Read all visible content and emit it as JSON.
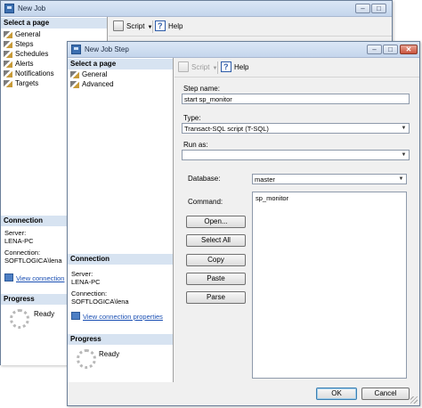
{
  "back_window": {
    "title": "New Job",
    "select_page_header": "Select a page",
    "pages": [
      {
        "label": "General"
      },
      {
        "label": "Steps"
      },
      {
        "label": "Schedules"
      },
      {
        "label": "Alerts"
      },
      {
        "label": "Notifications"
      },
      {
        "label": "Targets"
      }
    ],
    "toolbar": {
      "script_label": "Script",
      "help_label": "Help"
    },
    "connection": {
      "header": "Connection",
      "server_label": "Server:",
      "server_value": "LENA-PC",
      "connection_label": "Connection:",
      "connection_value": "SOFTLOGICA\\lena",
      "link_text": "View connection"
    },
    "progress": {
      "header": "Progress",
      "status": "Ready"
    }
  },
  "front_window": {
    "title": "New Job Step",
    "select_page_header": "Select a page",
    "pages": [
      {
        "label": "General"
      },
      {
        "label": "Advanced"
      }
    ],
    "toolbar": {
      "script_label": "Script",
      "help_label": "Help"
    },
    "form": {
      "step_name_label": "Step name:",
      "step_name_value": "start sp_monitor",
      "type_label": "Type:",
      "type_value": "Transact-SQL script (T-SQL)",
      "run_as_label": "Run as:",
      "run_as_value": "",
      "database_label": "Database:",
      "database_value": "master",
      "command_label": "Command:",
      "command_value": "sp_monitor"
    },
    "buttons": {
      "open": "Open...",
      "select_all": "Select All",
      "copy": "Copy",
      "paste": "Paste",
      "parse": "Parse"
    },
    "connection": {
      "header": "Connection",
      "server_label": "Server:",
      "server_value": "LENA-PC",
      "connection_label": "Connection:",
      "connection_value": "SOFTLOGICA\\lena",
      "link_text": "View connection properties"
    },
    "progress": {
      "header": "Progress",
      "status": "Ready"
    },
    "footer": {
      "ok": "OK",
      "cancel": "Cancel"
    }
  },
  "icons": {
    "page_icon": "wrench-page-icon",
    "script_icon": "script-icon",
    "help_icon": "help-icon",
    "link_icon": "connection-properties-icon",
    "progress_icon": "spinner-icon"
  }
}
